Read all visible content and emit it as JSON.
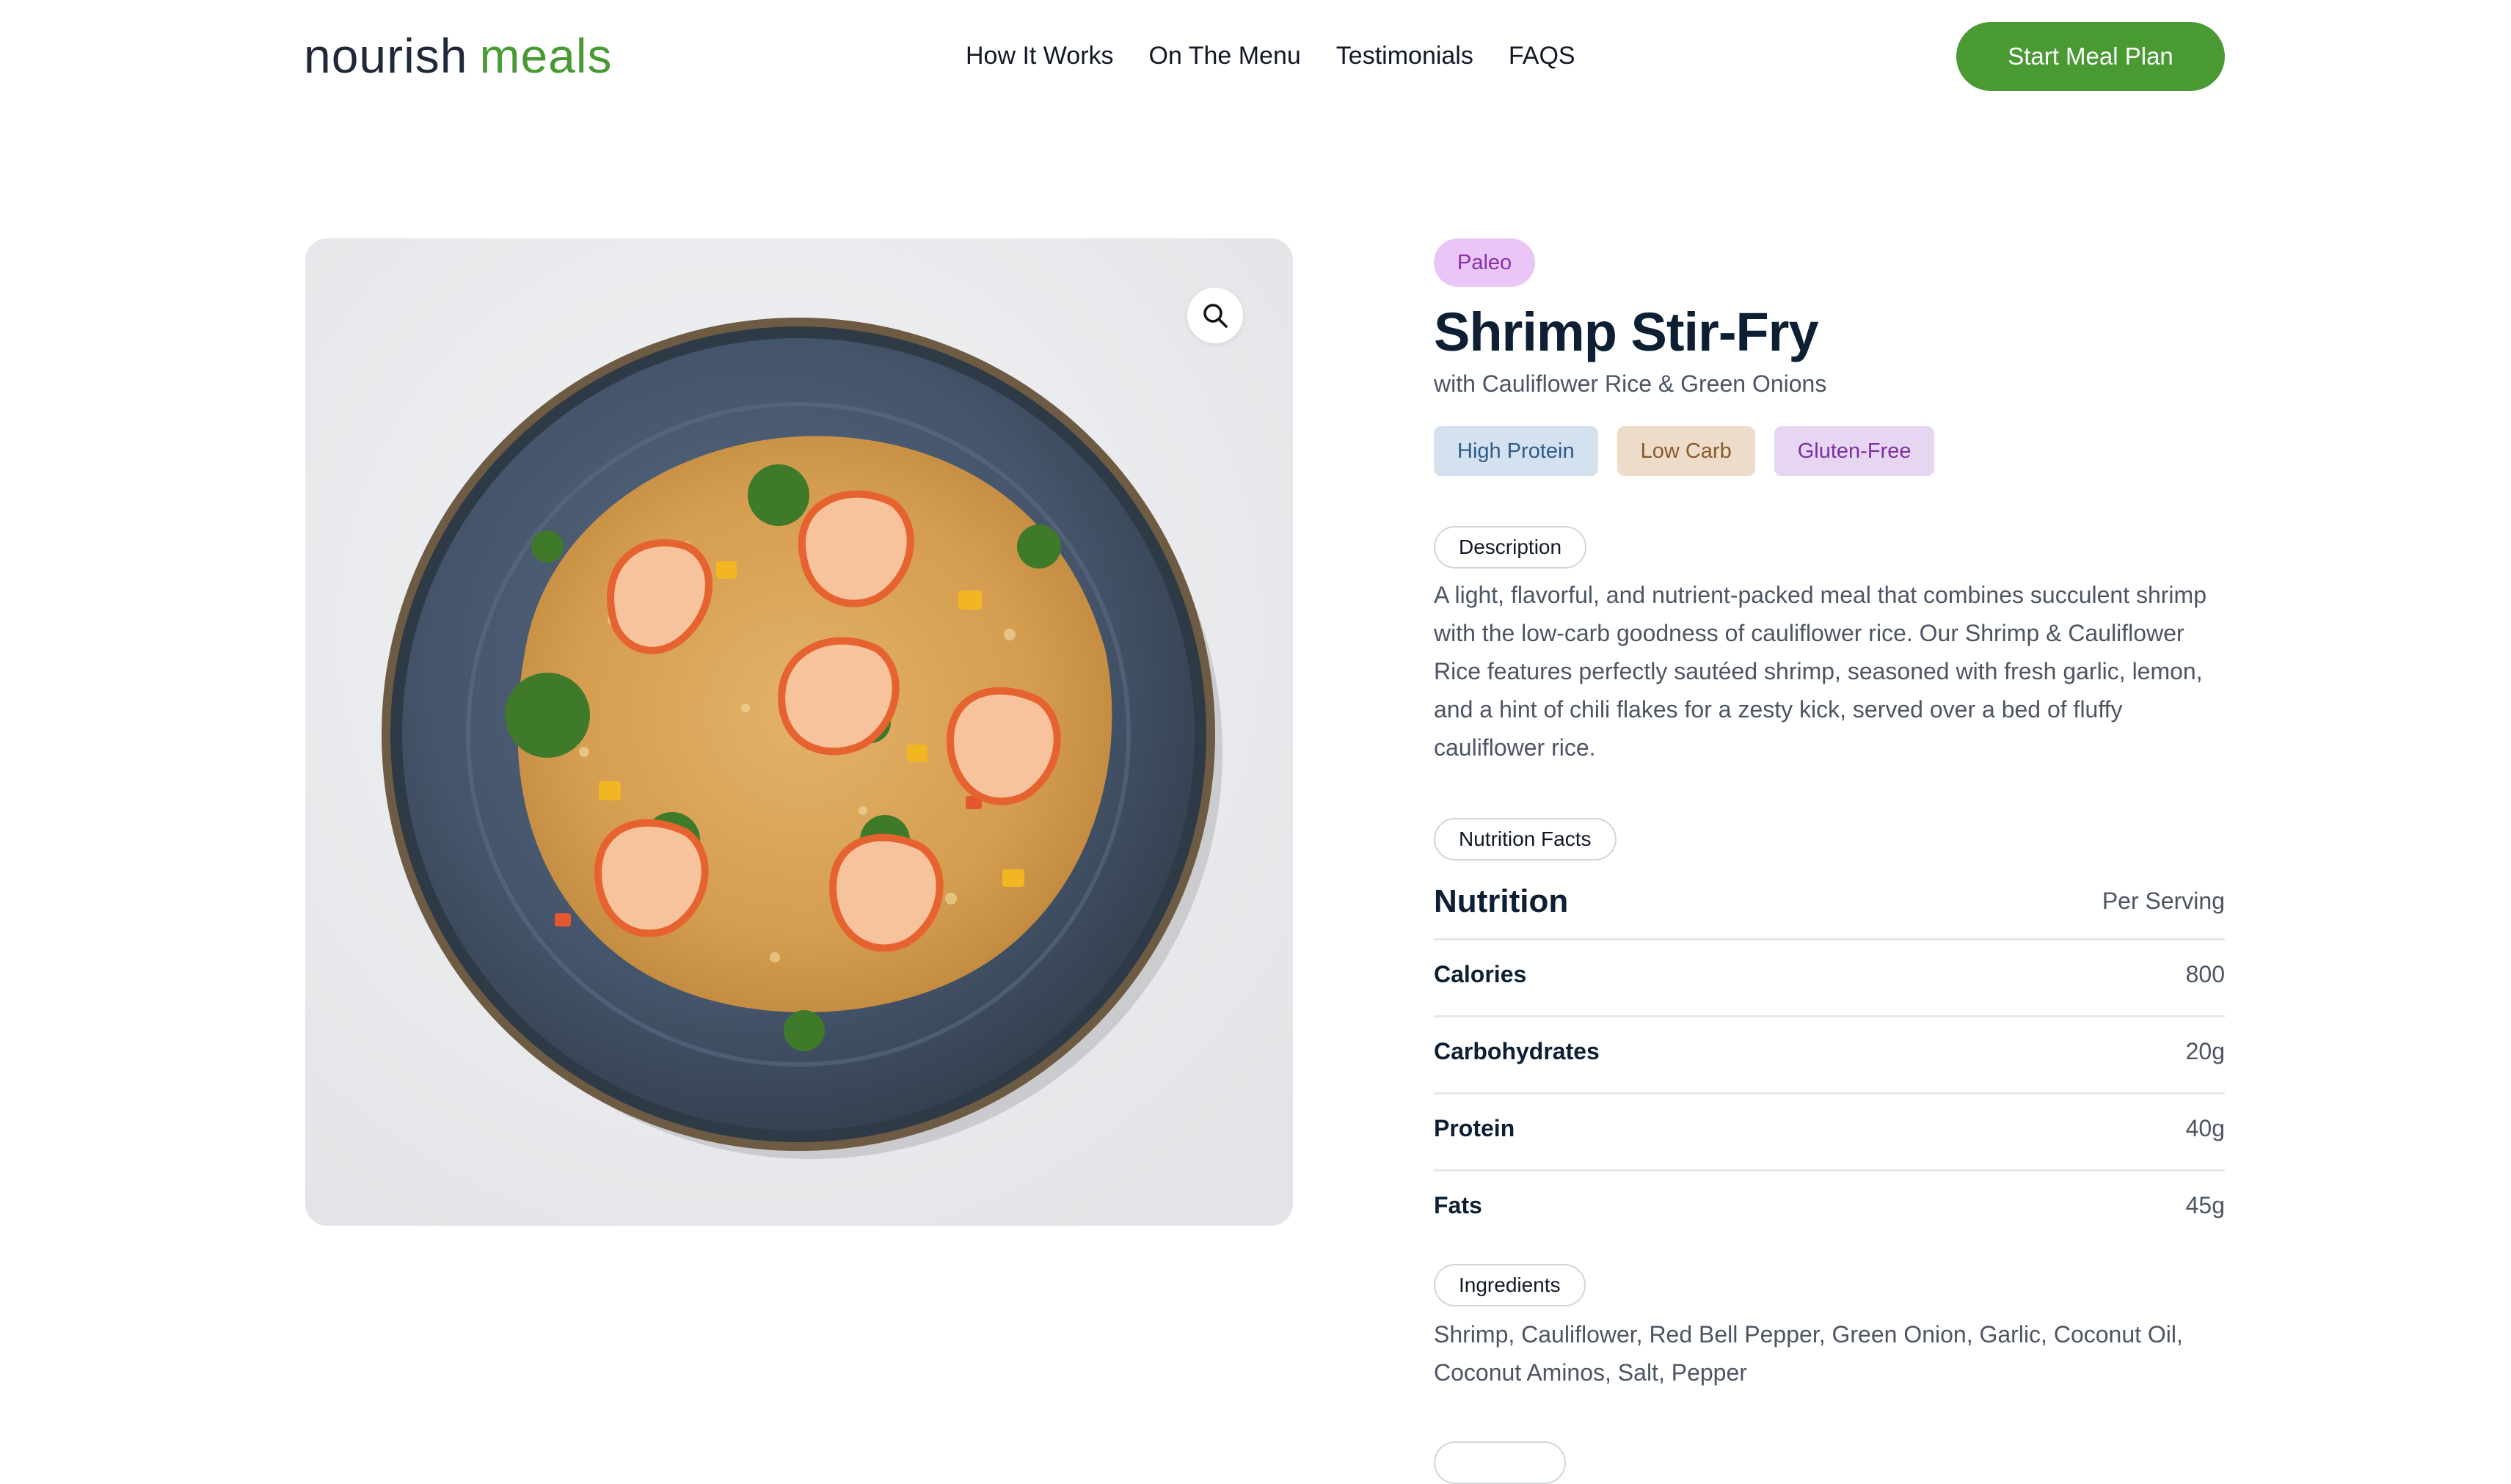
{
  "header": {
    "logo_part1": "nourish",
    "logo_part2": "meals",
    "nav": [
      "How It Works",
      "On The Menu",
      "Testimonials",
      "FAQS"
    ],
    "cta_label": "Start Meal Plan"
  },
  "product": {
    "image_alt": "Shrimp stir-fry with cauliflower rice on a blue plate",
    "zoom_icon": "search-icon",
    "diet_label": "Paleo",
    "title": "Shrimp Stir-Fry",
    "subtitle": "with Cauliflower Rice & Green Onions",
    "tags": [
      "High Protein",
      "Low Carb",
      "Gluten-Free"
    ],
    "description_label": "Description",
    "description": "A light, flavorful, and nutrient-packed meal that combines succulent shrimp with the low-carb goodness of cauliflower rice. Our Shrimp & Cauliflower Rice features perfectly sautéed shrimp, seasoned with fresh garlic, lemon, and a hint of chili flakes for a zesty kick, served over a bed of fluffy cauliflower rice.",
    "nutrition_label": "Nutrition Facts",
    "nutrition_title": "Nutrition",
    "nutrition_per": "Per Serving",
    "nutrition": [
      {
        "name": "Calories",
        "value": "800"
      },
      {
        "name": "Carbohydrates",
        "value": "20g"
      },
      {
        "name": "Protein",
        "value": "40g"
      },
      {
        "name": "Fats",
        "value": "45g"
      }
    ],
    "ingredients_label": "Ingredients",
    "ingredients": "Shrimp, Cauliflower, Red Bell Pepper, Green Onion, Garlic, Coconut Oil, Coconut Aminos, Salt, Pepper"
  },
  "colors": {
    "brand_green": "#4a9a34",
    "heading_navy": "#0c1f33",
    "paleo_pill_bg": "#e9c6f6",
    "tag_high_protein_bg": "#d4e1ef",
    "tag_low_carb_bg": "#ecdcc9",
    "tag_gluten_free_bg": "#e7d6f1"
  }
}
